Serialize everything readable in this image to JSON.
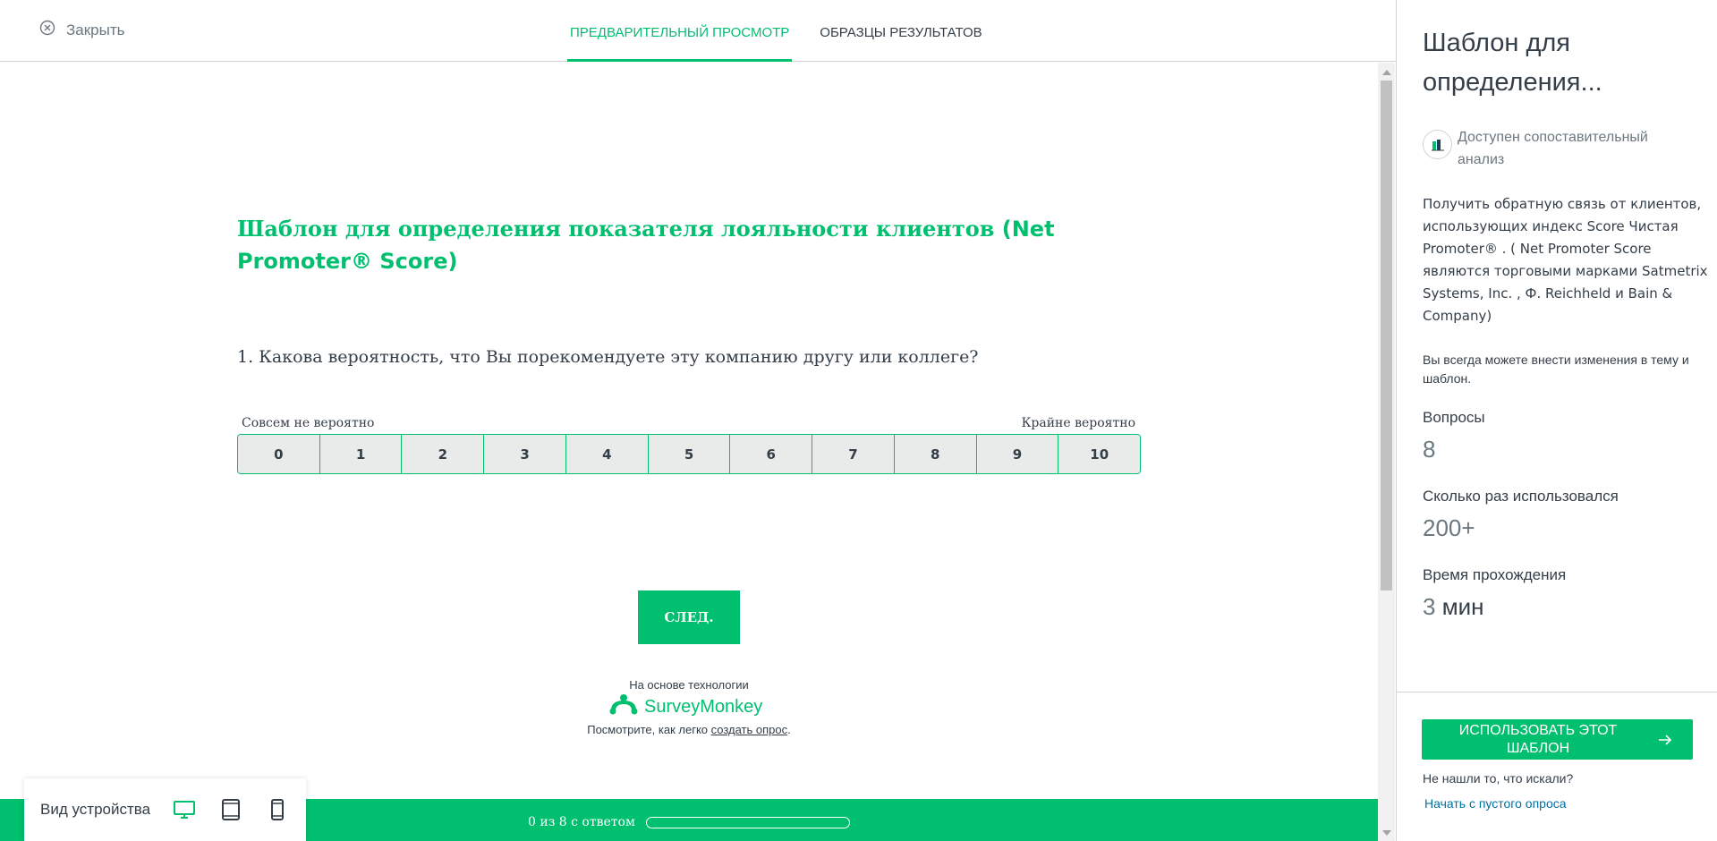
{
  "header": {
    "close_label": "Закрыть",
    "tabs": [
      {
        "label": "ПРЕДВАРИТЕЛЬНЫЙ ПРОСМОТР",
        "active": true
      },
      {
        "label": "ОБРАЗЦЫ РЕЗУЛЬТАТОВ",
        "active": false
      }
    ]
  },
  "survey": {
    "title_cyrillic": "Шаблон для определения показателя лояльности клиентов ",
    "title_latin": "(Net Promoter® Score)",
    "question": "1. Какова вероятность, что Вы порекомендуете эту компанию другу или коллеге?",
    "scale_left_label": "Совсем не вероятно",
    "scale_right_label": "Крайне вероятно",
    "scale": [
      "0",
      "1",
      "2",
      "3",
      "4",
      "5",
      "6",
      "7",
      "8",
      "9",
      "10"
    ],
    "next_label": "СЛЕД.",
    "powered_by": "На основе технологии",
    "brand": "SurveyMonkey",
    "see_how_prefix": "Посмотрите, как легко ",
    "see_how_link": "создать опрос",
    "see_how_suffix": "."
  },
  "progress": {
    "text": "0 из 8 с ответом",
    "answered": 0,
    "total": 8
  },
  "device_view": {
    "label": "Вид устройства",
    "icons": [
      "desktop-icon",
      "tablet-icon",
      "phone-icon"
    ],
    "active": "desktop-icon"
  },
  "sidebar": {
    "title": "Шаблон для определения...",
    "benchmark_text": "Доступен сопоставительный анализ",
    "description": "Получить обратную связь от клиентов, использующих индекс Score Чистая Promoter® . ( Net Promoter Score являются торговыми марками Satmetrix Systems, Inc. , Ф. Reichheld и Bain & Company)",
    "note": "Вы всегда можете внести изменения в тему и шаблон.",
    "questions_label": "Вопросы",
    "questions_value": "8",
    "used_label": "Сколько раз использовался",
    "used_value": "200+",
    "time_label": "Время прохождения",
    "time_value": "3",
    "time_unit": " мин",
    "use_button": "ИСПОЛЬЗОВАТЬ ЭТОТ ШАБЛОН",
    "not_found": "Не нашли то, что искали?",
    "blank_link": "Начать с пустого опроса"
  },
  "colors": {
    "brand_green": "#00bf6f",
    "text": "#333e48",
    "muted": "#6b787f",
    "link": "#0071a3"
  }
}
